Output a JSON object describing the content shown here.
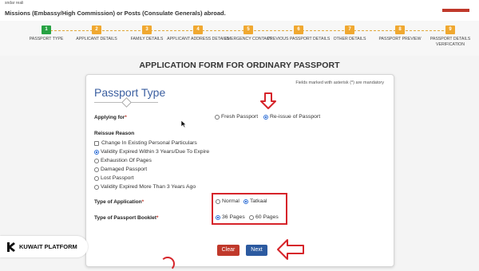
{
  "header": {
    "tiny_text": "sndar reali",
    "notice_text": "Missions (Embassy/High Commission) or Posts (Consulate Generals) abroad."
  },
  "steps": [
    {
      "num": "1",
      "label": "PASSPORT TYPE",
      "active": true
    },
    {
      "num": "2",
      "label": "APPLICANT DETAILS"
    },
    {
      "num": "3",
      "label": "FAMILY DETAILS"
    },
    {
      "num": "4",
      "label": "APPLICANT ADDRESS DETAILS"
    },
    {
      "num": "5",
      "label": "EMERGENCY CONTACT"
    },
    {
      "num": "6",
      "label": "PREVIOUS PASSPORT DETAILS"
    },
    {
      "num": "7",
      "label": "OTHER DETAILS"
    },
    {
      "num": "8",
      "label": "PASSPORT PREVIEW"
    },
    {
      "num": "9",
      "label": "PASSPORT DETAILS VERIFICATION"
    }
  ],
  "form": {
    "title": "APPLICATION FORM FOR ORDINARY PASSPORT",
    "mandatory_note": "Fields marked with asterisk (*) are mandatory",
    "section_title": "Passport Type",
    "applying_for": {
      "label": "Applying for",
      "options": [
        "Fresh Passport",
        "Re-issue of Passport"
      ],
      "selected": "Re-issue of Passport"
    },
    "reissue": {
      "label": "Reissue Reason",
      "checkbox": "Change In Existing Personal Particulars",
      "options": [
        "Validity Expired Within 3 Years/Due To Expire",
        "Exhaustion Of Pages",
        "Damaged Passport",
        "Lost Passport",
        "Validity Expired More Than 3 Years Ago"
      ],
      "selected": "Validity Expired Within 3 Years/Due To Expire"
    },
    "application_type": {
      "label": "Type of Application",
      "options": [
        "Normal",
        "Tatkaal"
      ],
      "selected": "Tatkaal"
    },
    "booklet": {
      "label": "Type of Passport Booklet",
      "options": [
        "36 Pages",
        "60 Pages"
      ],
      "selected": "36 Pages"
    },
    "buttons": {
      "clear": "Clear",
      "next": "Next"
    }
  },
  "brand": {
    "name": "KUWAIT PLATFORM"
  },
  "colors": {
    "accent": "#3b5fa0",
    "step": "#f0a830",
    "active_step": "#27a243",
    "highlight": "#d6242a",
    "next": "#2c5aa0",
    "clear": "#c0392b"
  }
}
